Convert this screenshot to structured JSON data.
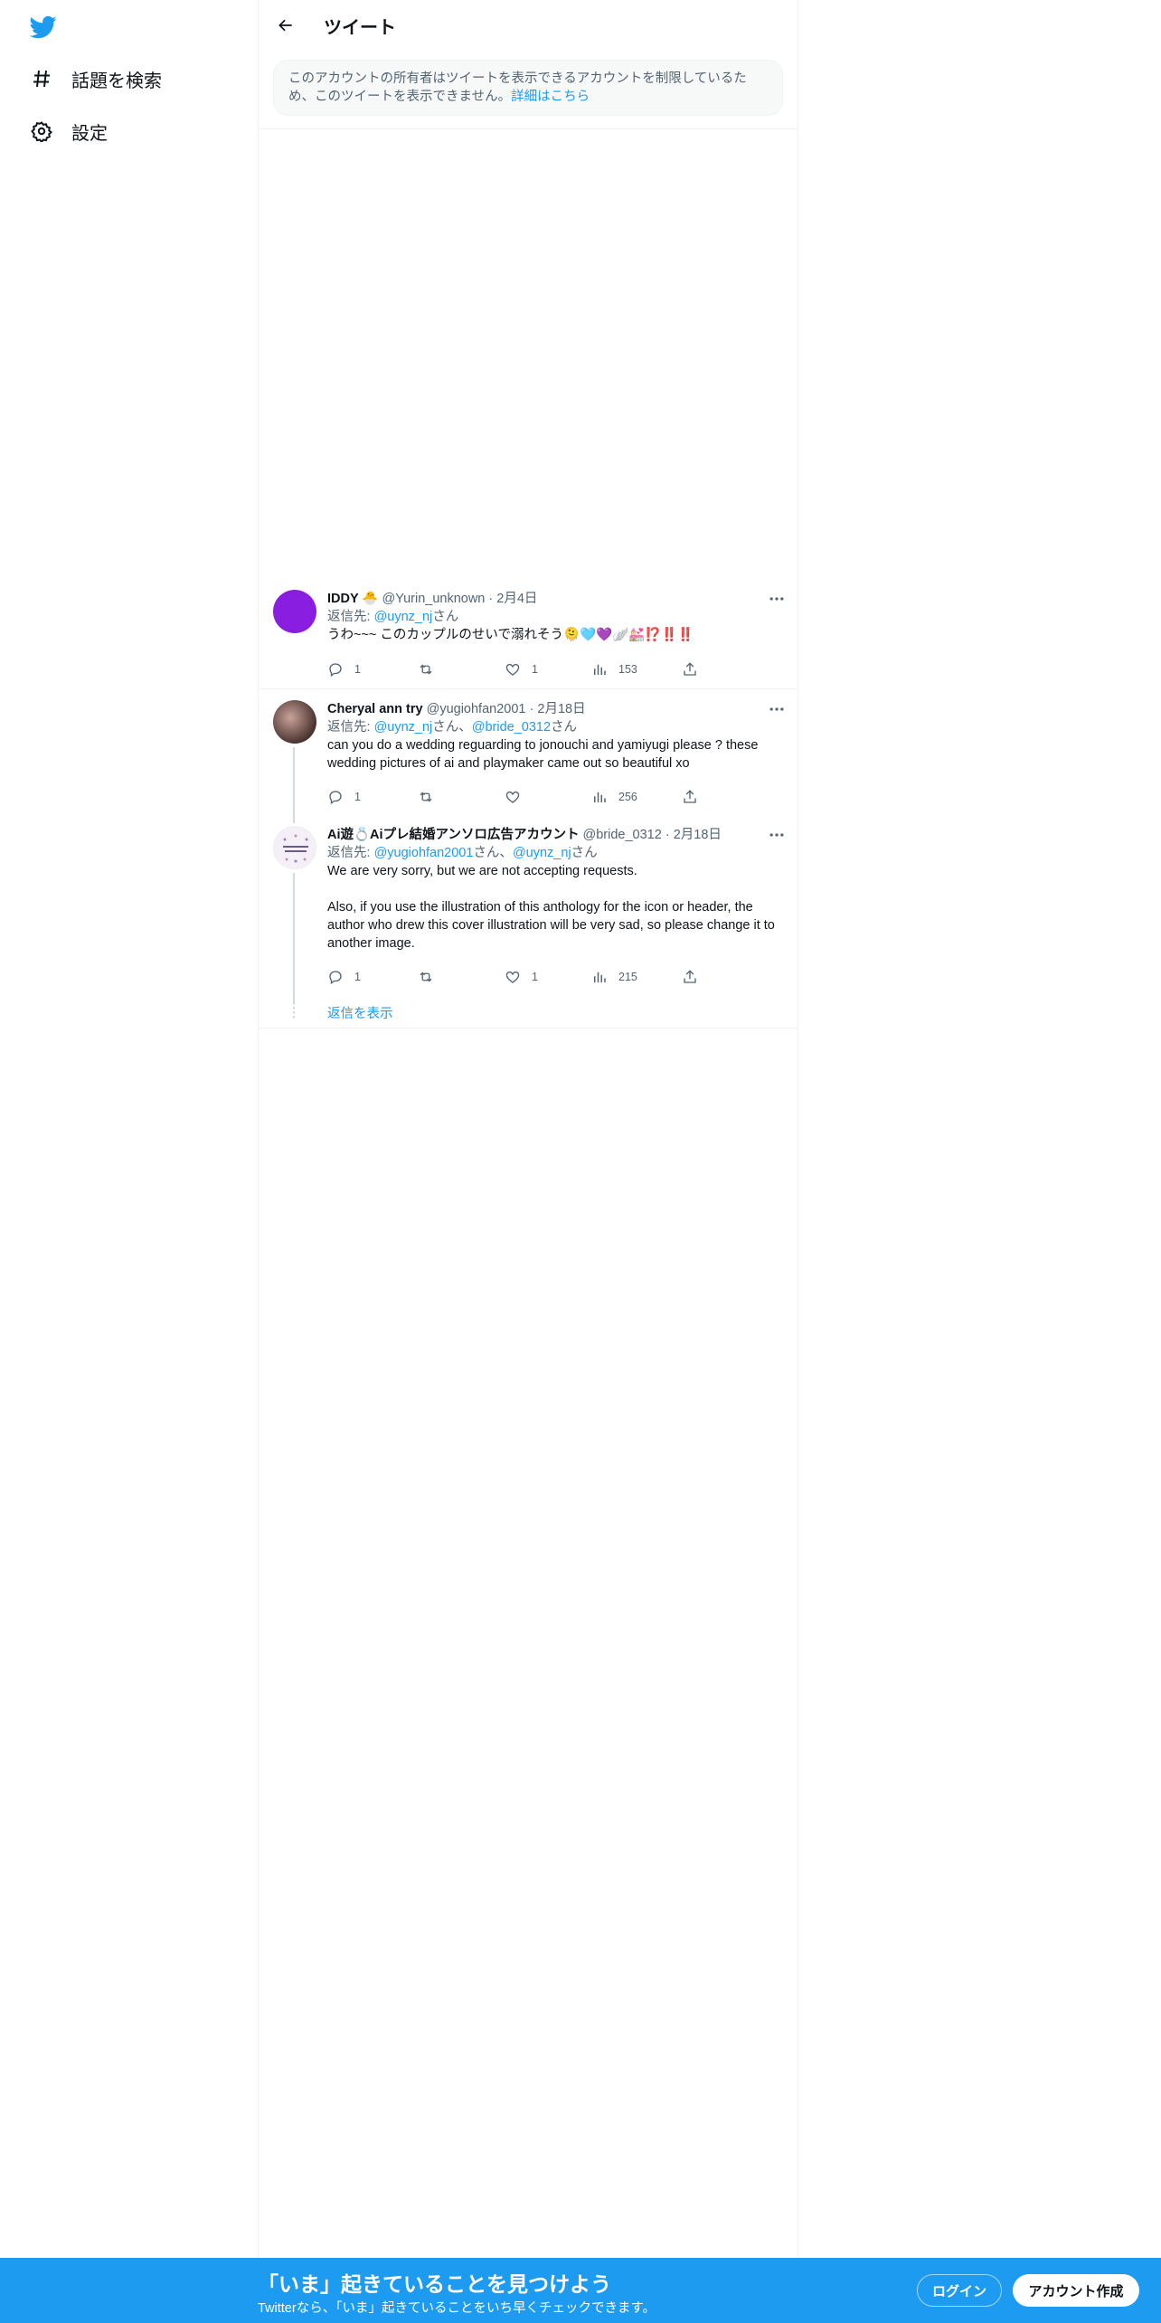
{
  "sidebar": {
    "logo": "twitter-bird-icon",
    "items": [
      {
        "label": "話題を検索",
        "icon": "hashtag-icon"
      },
      {
        "label": "設定",
        "icon": "gear-icon"
      }
    ]
  },
  "header": {
    "title": "ツイート"
  },
  "notice": {
    "text": "このアカウントの所有者はツイートを表示できるアカウントを制限しているため、このツイートを表示できません。",
    "link": "詳細はこちら"
  },
  "tweets": [
    {
      "name": "IDDY 🐣",
      "handle": "@Yurin_unknown",
      "time": "2月4日",
      "reply_prefix": "返信先: ",
      "mentions": [
        "@uynz_nj"
      ],
      "mention_suffix": "さん",
      "text": "うわ~~~ このカップルのせいで溺れそう🫠🩵💜🪽💒⁉️‼️‼️",
      "replies": "1",
      "retweets": "",
      "likes": "1",
      "views": "153",
      "avatar_color": "#8a1ee0"
    },
    {
      "name": "Cheryal ann try",
      "handle": "@yugiohfan2001",
      "time": "2月18日",
      "reply_prefix": "返信先: ",
      "mentions": [
        "@uynz_nj",
        "@bride_0312"
      ],
      "mention_joiner": "さん、",
      "mention_suffix": "さん",
      "text": "can you do a wedding reguarding to jonouchi and yamiyugi please ? these wedding pictures of ai and playmaker came out so beautiful xo",
      "replies": "1",
      "retweets": "",
      "likes": "",
      "views": "256"
    },
    {
      "name": "Ai遊💍Aiプレ結婚アンソロ広告アカウント",
      "handle": "@bride_0312",
      "time": "2月18日",
      "reply_prefix": "返信先: ",
      "mentions": [
        "@yugiohfan2001",
        "@uynz_nj"
      ],
      "mention_joiner": "さん、",
      "mention_suffix": "さん",
      "text": "We are very sorry, but we are not accepting requests.\n\nAlso, if you use the illustration of this anthology for the icon or header, the author who drew this cover illustration will be very sad, so please change it to another image.",
      "replies": "1",
      "retweets": "",
      "likes": "1",
      "views": "215"
    }
  ],
  "show_replies": "返信を表示",
  "banner": {
    "title": "「いま」起きていることを見つけよう",
    "subtitle": "Twitterなら、「いま」起きていることをいち早くチェックできます。",
    "login": "ログイン",
    "signup": "アカウント作成"
  },
  "colors": {
    "accent": "#1d9bf0",
    "text": "#0f1419",
    "secondary": "#536471",
    "border": "#eff3f4"
  }
}
